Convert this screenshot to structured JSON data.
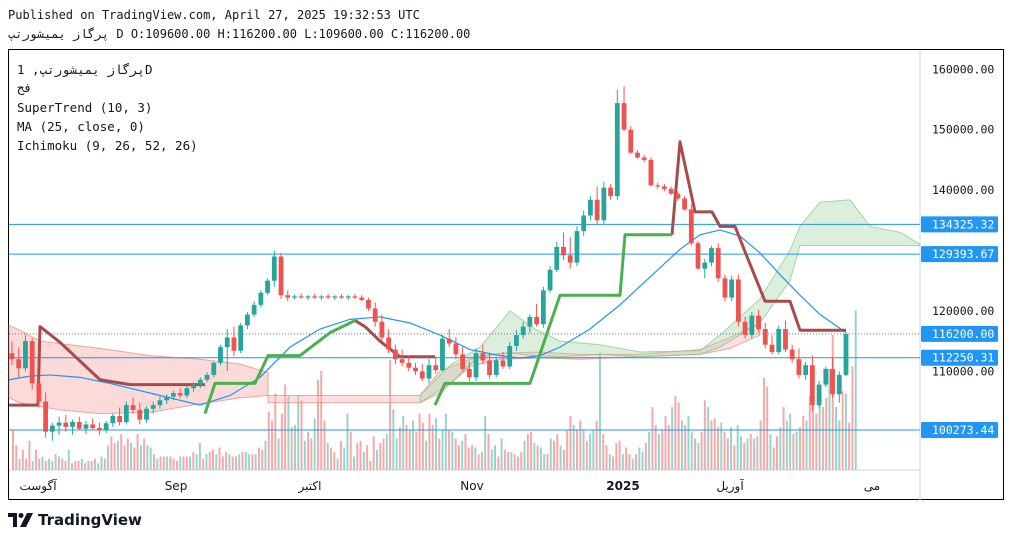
{
  "header": {
    "published": "Published on TradingView.com, April 27, 2025 19:32:53 UTC",
    "ohlc": "پرگاز یمیشورتپ D O:109600.00 H:116200.00 L:109600.00 C:116200.00"
  },
  "legend": {
    "symbol": "پرگاز یمیشورتپ, 1D",
    "exchange": "فح",
    "supertrend": "SuperTrend (10, 3)",
    "ma": "MA (25, close, 0)",
    "ichimoku": "Ichimoku (9, 26, 52, 26)"
  },
  "brand": {
    "name": "TradingView"
  },
  "colors": {
    "up": "#26a69a",
    "down": "#ef5350",
    "supertrend_up": "#4caf50",
    "supertrend_down": "#a84b4b",
    "ma": "#2196f3",
    "kumo_bull": "#a5d6a7",
    "kumo_bear": "#f8bbbb",
    "hline": "#2196f3",
    "current_price": "#2196f3"
  },
  "chart_data": {
    "type": "candlestick",
    "yaxis_ticks": [
      160000,
      150000,
      140000,
      130000,
      120000,
      110000,
      100000
    ],
    "yaxis_tick_labels": [
      "160000.00",
      "150000.00",
      "140000.00",
      "130000.00",
      "120000.00",
      "110000.00",
      "100000.00"
    ],
    "price_labels": [
      "134325.32",
      "129393.67",
      "116200.00",
      "112250.31",
      "100273.44"
    ],
    "horizontal_lines": [
      134325.32,
      129393.67,
      112250.31,
      100273.44
    ],
    "current_price": 116200.0,
    "xaxis_labels": [
      "آگوست",
      "Sep",
      "اکتبر",
      "Nov",
      "2025",
      "آوریل",
      "می"
    ],
    "candles": [
      [
        113000,
        115000,
        111000,
        112000
      ],
      [
        112000,
        114000,
        109000,
        110500
      ],
      [
        110500,
        116000,
        110000,
        115000
      ],
      [
        115000,
        115500,
        107000,
        108000
      ],
      [
        108000,
        109000,
        104000,
        105000
      ],
      [
        105000,
        106500,
        99000,
        100000
      ],
      [
        100000,
        101500,
        98500,
        101000
      ],
      [
        101000,
        102500,
        99500,
        101500
      ],
      [
        101500,
        102800,
        100000,
        100800
      ],
      [
        100800,
        102000,
        99500,
        101600
      ],
      [
        101600,
        102500,
        100200,
        100500
      ],
      [
        100500,
        101800,
        99600,
        101200
      ],
      [
        101200,
        102200,
        100400,
        100600
      ],
      [
        100600,
        101500,
        99400,
        100200
      ],
      [
        100200,
        101800,
        99800,
        101400
      ],
      [
        101400,
        103000,
        100800,
        102600
      ],
      [
        102600,
        104000,
        101000,
        101600
      ],
      [
        101600,
        105000,
        101200,
        104400
      ],
      [
        104400,
        105600,
        103000,
        103600
      ],
      [
        103600,
        104800,
        101200,
        102000
      ],
      [
        102000,
        104200,
        101500,
        103800
      ],
      [
        103800,
        105000,
        103000,
        104400
      ],
      [
        104400,
        105800,
        103800,
        105200
      ],
      [
        105200,
        106200,
        104600,
        105800
      ],
      [
        105800,
        106800,
        105200,
        106400
      ],
      [
        106400,
        107200,
        105600,
        106000
      ],
      [
        106000,
        107600,
        105600,
        107200
      ],
      [
        107200,
        108200,
        106600,
        107800
      ],
      [
        107800,
        109000,
        107200,
        108600
      ],
      [
        108600,
        109800,
        108200,
        109400
      ],
      [
        109400,
        111600,
        109000,
        111400
      ],
      [
        111400,
        114400,
        111000,
        114000
      ],
      [
        114000,
        117000,
        110000,
        115600
      ],
      [
        115600,
        117400,
        112600,
        113400
      ],
      [
        113400,
        118000,
        113000,
        117600
      ],
      [
        117600,
        119800,
        117000,
        119400
      ],
      [
        119400,
        121600,
        119000,
        121000
      ],
      [
        121000,
        123400,
        120600,
        123000
      ],
      [
        123000,
        125400,
        122600,
        125000
      ],
      [
        125000,
        130000,
        124000,
        129000
      ],
      [
        129000,
        129600,
        122000,
        122600
      ],
      [
        122600,
        123400,
        121600,
        122200
      ],
      [
        122200,
        122700,
        121900,
        122400
      ],
      [
        122400,
        122900,
        122000,
        122200
      ],
      [
        122200,
        122600,
        121800,
        122400
      ],
      [
        122400,
        122800,
        122000,
        122200
      ],
      [
        122200,
        122600,
        121800,
        122400
      ],
      [
        122400,
        122800,
        122000,
        122200
      ],
      [
        122200,
        122600,
        121800,
        122400
      ],
      [
        122400,
        122800,
        122000,
        122200
      ],
      [
        122200,
        122600,
        121800,
        122400
      ],
      [
        122400,
        122800,
        122000,
        122200
      ],
      [
        122200,
        122600,
        121600,
        121800
      ],
      [
        121800,
        122200,
        120000,
        120400
      ],
      [
        120400,
        121400,
        117400,
        118200
      ],
      [
        118200,
        119400,
        115000,
        115600
      ],
      [
        115600,
        117000,
        113000,
        113600
      ],
      [
        113600,
        114400,
        111200,
        112000
      ],
      [
        112000,
        113600,
        110800,
        111400
      ],
      [
        111400,
        112600,
        110000,
        110600
      ],
      [
        110600,
        111400,
        109400,
        110000
      ],
      [
        110000,
        111200,
        108400,
        108800
      ],
      [
        108800,
        112000,
        108000,
        111000
      ],
      [
        111000,
        112400,
        109600,
        110200
      ],
      [
        110200,
        116000,
        110000,
        115400
      ],
      [
        115400,
        117000,
        114000,
        114600
      ],
      [
        114600,
        115600,
        112000,
        112800
      ],
      [
        112800,
        114000,
        110000,
        110400
      ],
      [
        110400,
        111600,
        108400,
        109000
      ],
      [
        109000,
        113800,
        108400,
        113000
      ],
      [
        113000,
        114400,
        111200,
        111800
      ],
      [
        111800,
        113000,
        108800,
        109400
      ],
      [
        109400,
        112400,
        109000,
        111800
      ],
      [
        111800,
        113200,
        110400,
        110800
      ],
      [
        110800,
        114800,
        110400,
        114200
      ],
      [
        114200,
        116800,
        113400,
        116000
      ],
      [
        116000,
        118200,
        115400,
        117400
      ],
      [
        117400,
        119400,
        116400,
        119000
      ],
      [
        119000,
        121200,
        117400,
        117800
      ],
      [
        117800,
        124000,
        117200,
        123400
      ],
      [
        123400,
        127400,
        123000,
        126800
      ],
      [
        126800,
        131400,
        126400,
        130600
      ],
      [
        130600,
        133000,
        128400,
        129200
      ],
      [
        129200,
        132200,
        127000,
        128000
      ],
      [
        128000,
        134000,
        127400,
        133200
      ],
      [
        133200,
        136600,
        132400,
        135800
      ],
      [
        135800,
        139000,
        135000,
        138400
      ],
      [
        138400,
        140600,
        134200,
        135000
      ],
      [
        135000,
        141400,
        134400,
        140400
      ],
      [
        140400,
        141000,
        138400,
        139000
      ],
      [
        139000,
        156600,
        138400,
        154400
      ],
      [
        154400,
        157200,
        149800,
        150000
      ],
      [
        150000,
        150600,
        146000,
        146200
      ],
      [
        146200,
        146600,
        145200,
        145400
      ],
      [
        145400,
        145800,
        144600,
        145000
      ],
      [
        145000,
        145400,
        140600,
        140800
      ],
      [
        140800,
        141200,
        140200,
        140600
      ],
      [
        140600,
        141000,
        139800,
        140200
      ],
      [
        140200,
        140600,
        139200,
        139400
      ],
      [
        139400,
        139800,
        138200,
        138600
      ],
      [
        138600,
        139000,
        136600,
        136800
      ],
      [
        136800,
        137600,
        130800,
        131200
      ],
      [
        131200,
        131600,
        126800,
        127000
      ],
      [
        127000,
        128600,
        125400,
        128000
      ],
      [
        128000,
        130800,
        127400,
        130400
      ],
      [
        130400,
        131200,
        124800,
        125400
      ],
      [
        125400,
        126000,
        121600,
        122200
      ],
      [
        122200,
        125800,
        121600,
        125200
      ],
      [
        125200,
        126000,
        117400,
        118200
      ],
      [
        118200,
        119000,
        115400,
        116000
      ],
      [
        116000,
        119800,
        115400,
        119200
      ],
      [
        119200,
        120200,
        116400,
        117000
      ],
      [
        117000,
        118000,
        113800,
        114400
      ],
      [
        114400,
        116000,
        112800,
        113200
      ],
      [
        113200,
        117600,
        112800,
        117000
      ],
      [
        117000,
        118400,
        113200,
        113600
      ],
      [
        113600,
        114400,
        111400,
        112000
      ],
      [
        112000,
        113800,
        108800,
        109400
      ],
      [
        109400,
        111600,
        108600,
        111000
      ],
      [
        111000,
        112600,
        103400,
        104400
      ],
      [
        104400,
        108400,
        104000,
        107800
      ],
      [
        107800,
        110800,
        107400,
        110400
      ],
      [
        110400,
        112400,
        105600,
        106200
      ],
      [
        106200,
        110000,
        104800,
        109400
      ],
      [
        109400,
        116200,
        109200,
        116200
      ]
    ],
    "volumes": [
      0.18,
      0.11,
      0.05,
      0.09,
      0.05,
      0.13,
      0.04,
      0.09,
      0.05,
      0.06,
      0.04,
      0.05,
      0.04,
      0.07,
      0.06,
      0.05,
      0.04,
      0.09,
      0.03,
      0.04,
      0.04,
      0.05,
      0.03,
      0.04,
      0.04,
      0.05,
      0.03,
      0.06,
      0.05,
      0.11,
      0.15,
      0.12,
      0.13,
      0.16,
      0.11,
      0.14,
      0.12,
      0.1,
      0.16,
      0.11,
      0.14,
      0.11,
      0.1,
      0.07,
      0.05,
      0.06,
      0.06,
      0.06,
      0.06,
      0.05,
      0.04,
      0.06,
      0.06,
      0.06,
      0.06,
      0.08,
      0.07,
      0.12,
      0.05,
      0.07,
      0.08,
      0.09,
      0.07,
      0.1,
      0.06,
      0.08,
      0.07,
      0.06,
      0.06,
      0.07,
      0.08,
      0.08,
      0.07,
      0.07,
      0.07,
      0.1,
      0.09,
      0.13,
      0.26,
      0.22,
      0.34,
      0.14,
      0.25,
      0.38,
      0.33,
      0.19,
      0.2,
      0.33,
      0.31,
      0.13,
      0.17,
      0.14,
      0.23,
      0.4,
      0.44,
      0.22,
      0.12,
      0.1,
      0.08,
      0.05,
      0.13,
      0.1,
      0.25,
      0.17,
      0.06,
      0.12,
      0.13,
      0.08,
      0.11,
      0.04,
      0.15,
      0.09,
      0.12,
      0.14,
      0.16,
      0.49,
      0.27,
      0.14,
      0.19,
      0.24,
      0.2,
      0.18,
      0.22,
      0.17,
      0.25,
      0.21,
      0.13,
      0.25,
      0.2,
      0.23,
      0.14,
      0.18,
      0.25,
      0.18,
      0.17,
      0.14,
      0.11,
      0.13,
      0.16,
      0.1,
      0.11,
      0.1,
      0.07,
      0.08,
      0.24,
      0.16,
      0.09,
      0.11,
      0.06,
      0.14,
      0.09,
      0.08,
      0.08,
      0.07,
      0.06,
      0.08,
      0.13,
      0.16,
      0.17,
      0.12,
      0.11,
      0.1,
      0.07,
      0.07,
      0.14,
      0.13,
      0.16,
      0.11,
      0.09,
      0.18,
      0.24,
      0.2,
      0.18,
      0.22,
      0.18,
      0.13,
      0.16,
      0.18,
      0.22,
      0.52,
      0.16,
      0.11,
      0.07,
      0.06,
      0.12,
      0.13,
      0.07,
      0.1,
      0.07,
      0.05,
      0.07,
      0.1,
      0.08,
      0.12,
      0.17,
      0.28,
      0.2,
      0.16,
      0.18,
      0.24,
      0.2,
      0.28,
      0.33,
      0.3,
      0.22,
      0.2,
      0.24,
      0.17,
      0.14,
      0.12,
      0.17,
      0.31,
      0.28,
      0.22,
      0.23,
      0.19,
      0.21,
      0.17,
      0.14,
      0.19,
      0.11,
      0.2,
      0.15,
      0.12,
      0.14,
      0.16,
      0.14,
      0.15,
      0.22,
      0.41,
      0.37,
      0.16,
      0.1,
      0.15,
      0.19,
      0.28,
      0.22,
      0.25,
      0.16,
      0.17,
      0.19,
      0.24,
      0.22,
      0.33,
      0.42,
      0.25,
      0.3,
      0.28,
      0.32,
      0.45,
      0.6,
      0.28,
      0.22,
      0.35,
      0.34,
      0.21,
      0.46,
      0.71
    ]
  }
}
